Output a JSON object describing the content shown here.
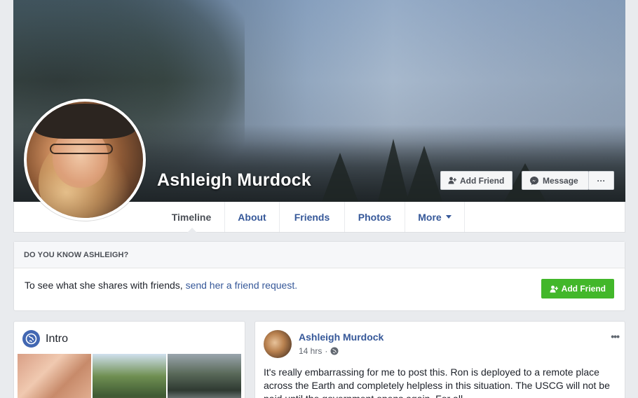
{
  "profile": {
    "name": "Ashleigh Murdock"
  },
  "cover_actions": {
    "add_friend_label": "Add Friend",
    "message_label": "Message",
    "more_label": "···"
  },
  "nav": {
    "tabs": [
      {
        "label": "Timeline",
        "active": true
      },
      {
        "label": "About"
      },
      {
        "label": "Friends"
      },
      {
        "label": "Photos"
      },
      {
        "label": "More"
      }
    ]
  },
  "know": {
    "header": "DO YOU KNOW ASHLEIGH?",
    "text": "To see what she shares with friends,",
    "link": "send her a friend request.",
    "button_label": "Add Friend"
  },
  "intro": {
    "title": "Intro"
  },
  "post": {
    "author": "Ashleigh Murdock",
    "time": "14 hrs",
    "separator": "·",
    "menu": "•••",
    "body": "It's really embarrassing for me to post this. Ron is deployed to a remote place across the Earth and completely helpless in this situation. The USCG will not be paid until the government opens again. For all"
  },
  "colors": {
    "link_blue": "#365899",
    "green_button": "#42b72a",
    "page_bg": "#e9ebee"
  }
}
